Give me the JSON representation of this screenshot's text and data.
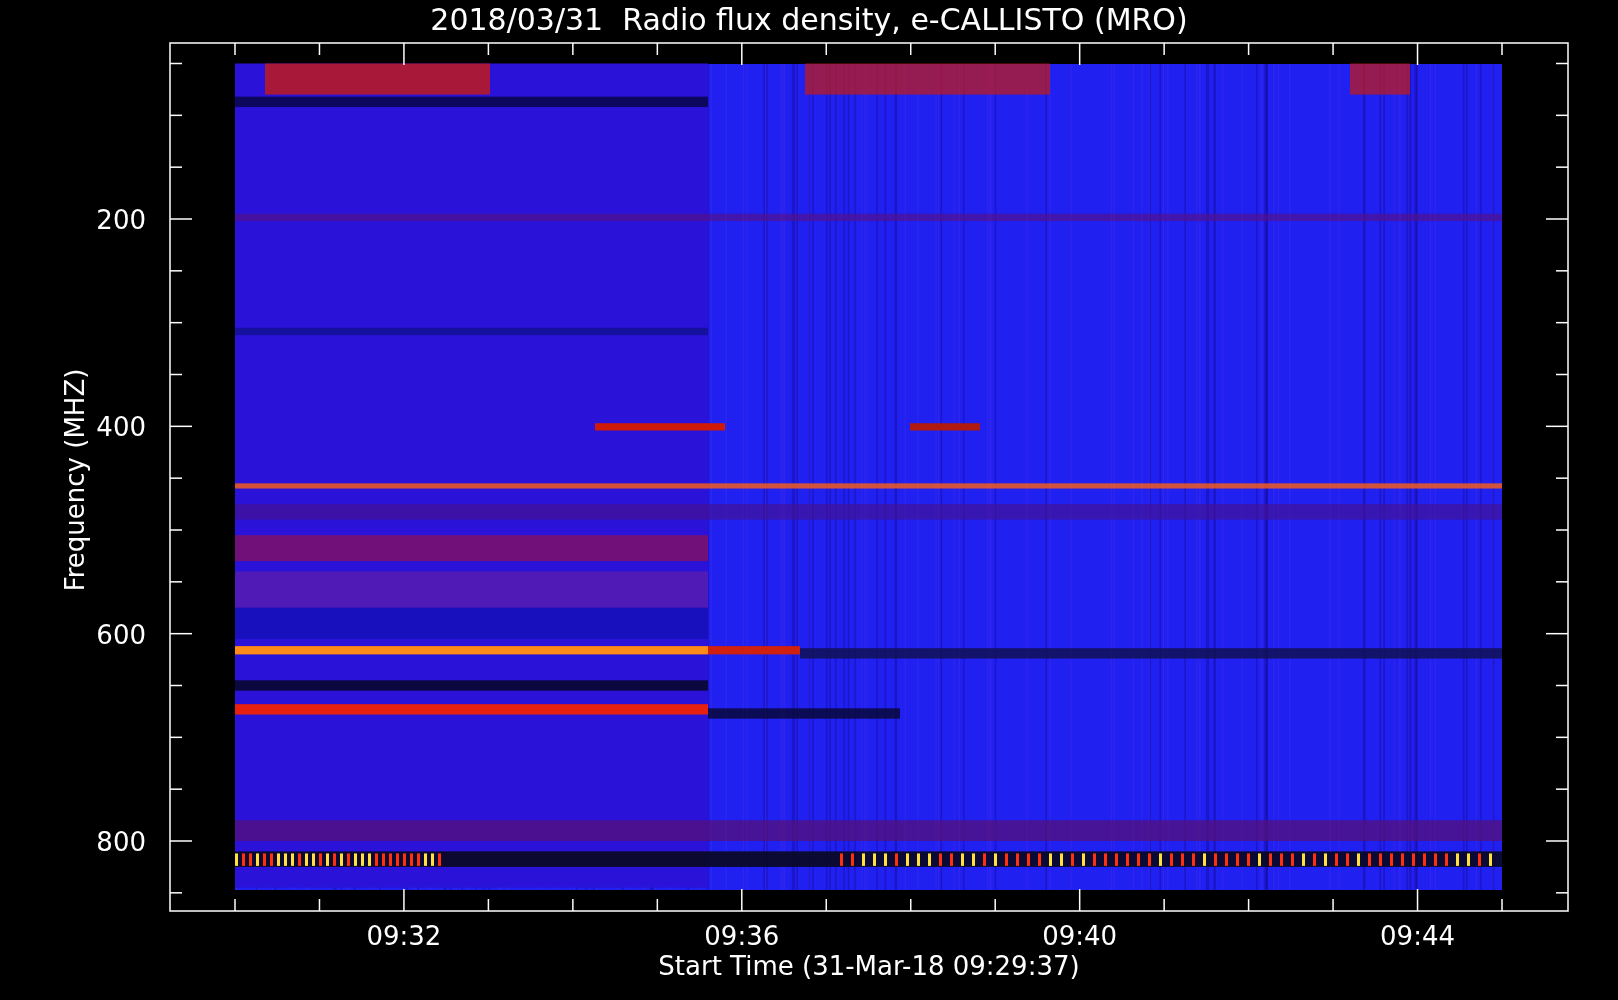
{
  "title": "2018/03/31  Radio flux density, e-CALLISTO (MRO)",
  "plot": {
    "ylabel": "Frequency (MHZ)",
    "xlabel": "Start Time (31-Mar-18 09:29:37)",
    "yticks": [
      "200",
      "400",
      "600",
      "800"
    ],
    "xticks": [
      "09:32",
      "09:36",
      "09:40",
      "09:44"
    ]
  }
}
